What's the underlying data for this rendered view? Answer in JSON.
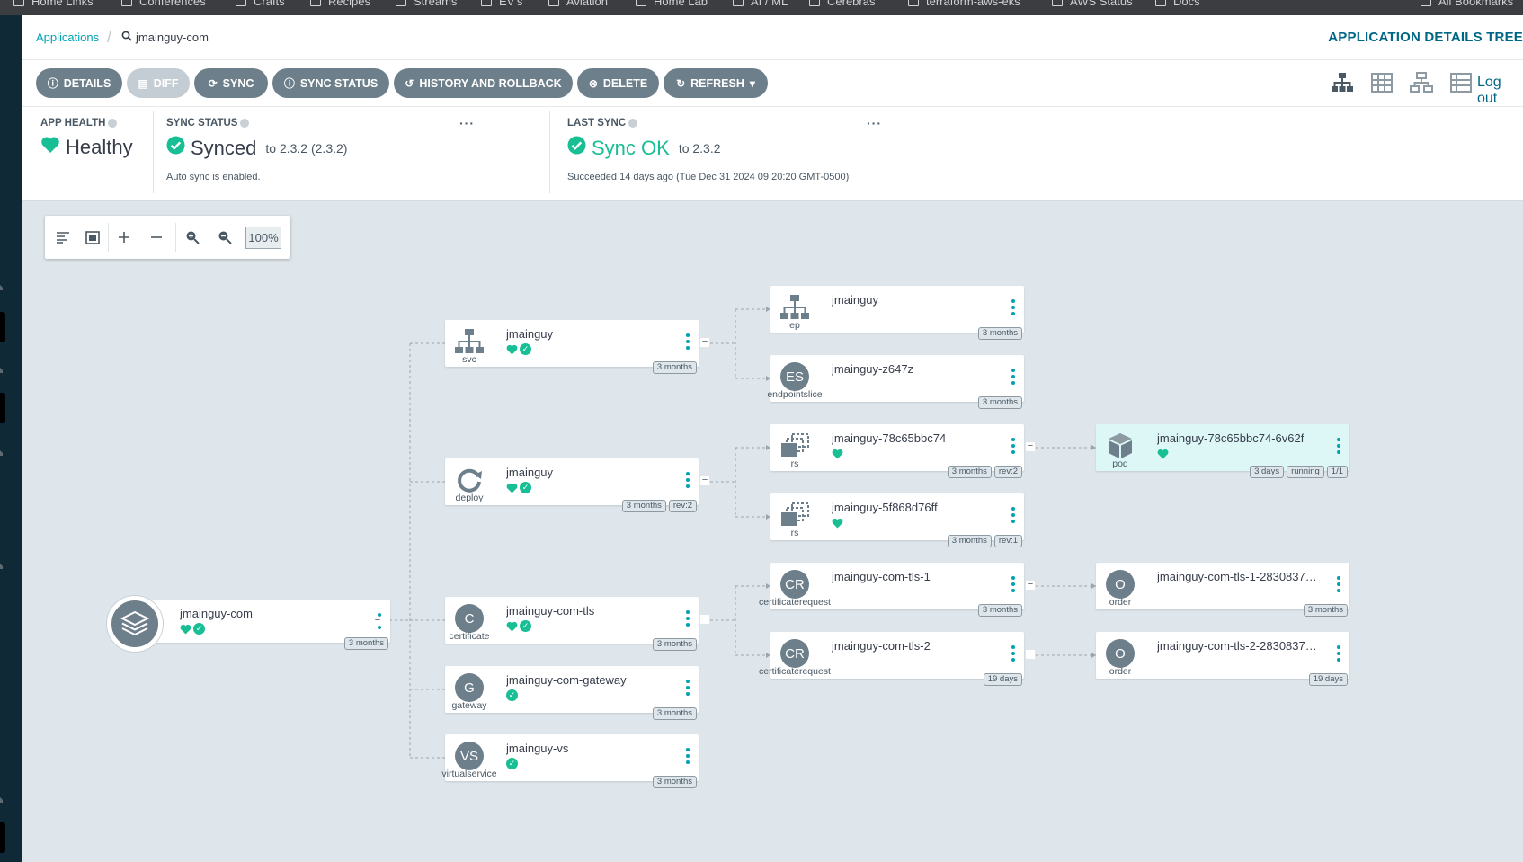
{
  "bookmarks": [
    "Home Links",
    "Conferences",
    "Crafts",
    "Recipes",
    "Streams",
    "EV's",
    "Aviation",
    "Home Lab",
    "AI / ML",
    "Cerebras",
    "terraform-aws-eks",
    "AWS Status",
    "Docs",
    "All Bookmarks"
  ],
  "breadcrumb": {
    "root": "Applications",
    "current": "jmainguy-com"
  },
  "page_title": "APPLICATION DETAILS TREE",
  "toolbar": {
    "details": "DETAILS",
    "diff": "DIFF",
    "sync": "SYNC",
    "sync_status": "SYNC STATUS",
    "history": "HISTORY AND ROLLBACK",
    "delete": "DELETE",
    "refresh": "REFRESH",
    "logout": "Log out"
  },
  "status": {
    "app_health_label": "APP HEALTH",
    "app_health_value": "Healthy",
    "sync_status_label": "SYNC STATUS",
    "sync_status_value": "Synced",
    "sync_status_to": "to 2.3.2 (2.3.2)",
    "auto_sync": "Auto sync is enabled.",
    "last_sync_label": "LAST SYNC",
    "last_sync_value": "Sync OK",
    "last_sync_to": "to 2.3.2",
    "last_sync_detail": "Succeeded 14 days ago (Tue Dec 31 2024 09:20:20 GMT-0500)",
    "more": "···"
  },
  "graph_tools": {
    "zoom": "100%"
  },
  "root_node": {
    "name": "jmainguy-com",
    "age": "3 months"
  },
  "nodes": [
    {
      "name": "jmainguy",
      "kind": "svc",
      "tags": [
        "3 months"
      ],
      "icon_text": ""
    },
    {
      "name": "jmainguy",
      "kind": "deploy",
      "tags": [
        "3 months",
        "rev:2"
      ],
      "icon_text": ""
    },
    {
      "name": "jmainguy-com-tls",
      "kind": "certificate",
      "tags": [
        "3 months"
      ],
      "icon_text": "C"
    },
    {
      "name": "jmainguy-com-gateway",
      "kind": "gateway",
      "tags": [
        "3 months"
      ],
      "icon_text": "G"
    },
    {
      "name": "jmainguy-vs",
      "kind": "virtualservice",
      "tags": [
        "3 months"
      ],
      "icon_text": "VS"
    },
    {
      "name": "jmainguy",
      "kind": "ep",
      "tags": [
        "3 months"
      ],
      "icon_text": ""
    },
    {
      "name": "jmainguy-z647z",
      "kind": "endpointslice",
      "tags": [
        "3 months"
      ],
      "icon_text": "ES"
    },
    {
      "name": "jmainguy-78c65bbc74",
      "kind": "rs",
      "tags": [
        "3 months",
        "rev:2"
      ],
      "icon_text": ""
    },
    {
      "name": "jmainguy-5f868d76ff",
      "kind": "rs",
      "tags": [
        "3 months",
        "rev:1"
      ],
      "icon_text": ""
    },
    {
      "name": "jmainguy-com-tls-1",
      "kind": "certificaterequest",
      "tags": [
        "3 months"
      ],
      "icon_text": "CR"
    },
    {
      "name": "jmainguy-com-tls-2",
      "kind": "certificaterequest",
      "tags": [
        "19 days"
      ],
      "icon_text": "CR"
    },
    {
      "name": "jmainguy-78c65bbc74-6v62f",
      "kind": "pod",
      "tags": [
        "3 days",
        "running",
        "1/1"
      ],
      "icon_text": ""
    },
    {
      "name": "jmainguy-com-tls-1-2830837…",
      "kind": "order",
      "tags": [
        "3 months"
      ],
      "icon_text": "O"
    },
    {
      "name": "jmainguy-com-tls-2-2830837…",
      "kind": "order",
      "tags": [
        "19 days"
      ],
      "icon_text": "O"
    }
  ],
  "colors": {
    "accent": "#00a2b3",
    "healthy": "#18be94",
    "button": "#6d7f8b",
    "canvas": "#dee6eb"
  }
}
